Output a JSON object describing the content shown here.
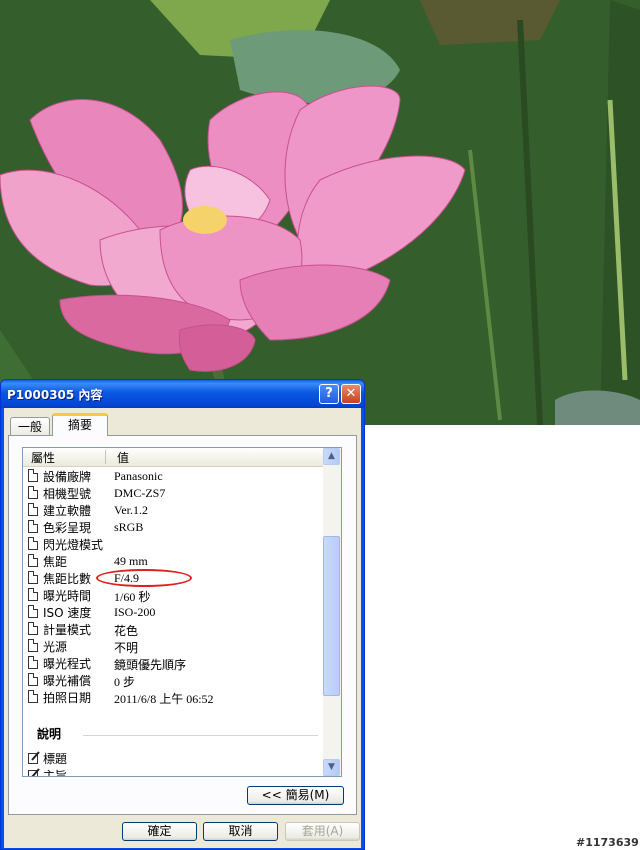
{
  "dialog": {
    "title": "P1000305 內容",
    "help_glyph": "?",
    "close_glyph": "✕",
    "tabs": [
      "一般",
      "摘要"
    ],
    "columns": [
      "屬性",
      "值"
    ],
    "properties": [
      {
        "name": "設備廠牌",
        "value": "Panasonic"
      },
      {
        "name": "相機型號",
        "value": "DMC-ZS7"
      },
      {
        "name": "建立軟體",
        "value": "Ver.1.2"
      },
      {
        "name": "色彩呈現",
        "value": "sRGB"
      },
      {
        "name": "閃光燈模式",
        "value": ""
      },
      {
        "name": "焦距",
        "value": "49 mm"
      },
      {
        "name": "焦距比數",
        "value": "F/4.9"
      },
      {
        "name": "曝光時間",
        "value": "1/60 秒"
      },
      {
        "name": "ISO 速度",
        "value": "ISO-200"
      },
      {
        "name": "計量模式",
        "value": "花色"
      },
      {
        "name": "光源",
        "value": "不明"
      },
      {
        "name": "曝光程式",
        "value": "鏡頭優先順序"
      },
      {
        "name": "曝光補償",
        "value": "0 步"
      },
      {
        "name": "拍照日期",
        "value": "2011/6/8 上午 06:52"
      }
    ],
    "description_section": "說明",
    "description_items": [
      "標題",
      "主旨"
    ],
    "simple_button": "<< 簡易(M)",
    "ok_button": "確定",
    "cancel_button": "取消",
    "apply_button": "套用(A)"
  },
  "watermark": "#1173639",
  "colors": {
    "annotation": "#e0201c",
    "title_bar": "#0054e3"
  }
}
